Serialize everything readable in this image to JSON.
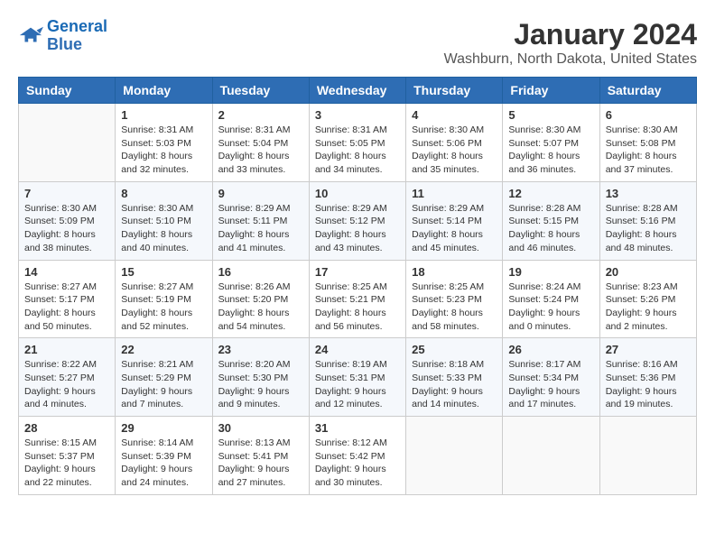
{
  "header": {
    "logo_line1": "General",
    "logo_line2": "Blue",
    "title": "January 2024",
    "subtitle": "Washburn, North Dakota, United States"
  },
  "days_of_week": [
    "Sunday",
    "Monday",
    "Tuesday",
    "Wednesday",
    "Thursday",
    "Friday",
    "Saturday"
  ],
  "weeks": [
    [
      {
        "day": "",
        "info": ""
      },
      {
        "day": "1",
        "info": "Sunrise: 8:31 AM\nSunset: 5:03 PM\nDaylight: 8 hours\nand 32 minutes."
      },
      {
        "day": "2",
        "info": "Sunrise: 8:31 AM\nSunset: 5:04 PM\nDaylight: 8 hours\nand 33 minutes."
      },
      {
        "day": "3",
        "info": "Sunrise: 8:31 AM\nSunset: 5:05 PM\nDaylight: 8 hours\nand 34 minutes."
      },
      {
        "day": "4",
        "info": "Sunrise: 8:30 AM\nSunset: 5:06 PM\nDaylight: 8 hours\nand 35 minutes."
      },
      {
        "day": "5",
        "info": "Sunrise: 8:30 AM\nSunset: 5:07 PM\nDaylight: 8 hours\nand 36 minutes."
      },
      {
        "day": "6",
        "info": "Sunrise: 8:30 AM\nSunset: 5:08 PM\nDaylight: 8 hours\nand 37 minutes."
      }
    ],
    [
      {
        "day": "7",
        "info": "Sunrise: 8:30 AM\nSunset: 5:09 PM\nDaylight: 8 hours\nand 38 minutes."
      },
      {
        "day": "8",
        "info": "Sunrise: 8:30 AM\nSunset: 5:10 PM\nDaylight: 8 hours\nand 40 minutes."
      },
      {
        "day": "9",
        "info": "Sunrise: 8:29 AM\nSunset: 5:11 PM\nDaylight: 8 hours\nand 41 minutes."
      },
      {
        "day": "10",
        "info": "Sunrise: 8:29 AM\nSunset: 5:12 PM\nDaylight: 8 hours\nand 43 minutes."
      },
      {
        "day": "11",
        "info": "Sunrise: 8:29 AM\nSunset: 5:14 PM\nDaylight: 8 hours\nand 45 minutes."
      },
      {
        "day": "12",
        "info": "Sunrise: 8:28 AM\nSunset: 5:15 PM\nDaylight: 8 hours\nand 46 minutes."
      },
      {
        "day": "13",
        "info": "Sunrise: 8:28 AM\nSunset: 5:16 PM\nDaylight: 8 hours\nand 48 minutes."
      }
    ],
    [
      {
        "day": "14",
        "info": "Sunrise: 8:27 AM\nSunset: 5:17 PM\nDaylight: 8 hours\nand 50 minutes."
      },
      {
        "day": "15",
        "info": "Sunrise: 8:27 AM\nSunset: 5:19 PM\nDaylight: 8 hours\nand 52 minutes."
      },
      {
        "day": "16",
        "info": "Sunrise: 8:26 AM\nSunset: 5:20 PM\nDaylight: 8 hours\nand 54 minutes."
      },
      {
        "day": "17",
        "info": "Sunrise: 8:25 AM\nSunset: 5:21 PM\nDaylight: 8 hours\nand 56 minutes."
      },
      {
        "day": "18",
        "info": "Sunrise: 8:25 AM\nSunset: 5:23 PM\nDaylight: 8 hours\nand 58 minutes."
      },
      {
        "day": "19",
        "info": "Sunrise: 8:24 AM\nSunset: 5:24 PM\nDaylight: 9 hours\nand 0 minutes."
      },
      {
        "day": "20",
        "info": "Sunrise: 8:23 AM\nSunset: 5:26 PM\nDaylight: 9 hours\nand 2 minutes."
      }
    ],
    [
      {
        "day": "21",
        "info": "Sunrise: 8:22 AM\nSunset: 5:27 PM\nDaylight: 9 hours\nand 4 minutes."
      },
      {
        "day": "22",
        "info": "Sunrise: 8:21 AM\nSunset: 5:29 PM\nDaylight: 9 hours\nand 7 minutes."
      },
      {
        "day": "23",
        "info": "Sunrise: 8:20 AM\nSunset: 5:30 PM\nDaylight: 9 hours\nand 9 minutes."
      },
      {
        "day": "24",
        "info": "Sunrise: 8:19 AM\nSunset: 5:31 PM\nDaylight: 9 hours\nand 12 minutes."
      },
      {
        "day": "25",
        "info": "Sunrise: 8:18 AM\nSunset: 5:33 PM\nDaylight: 9 hours\nand 14 minutes."
      },
      {
        "day": "26",
        "info": "Sunrise: 8:17 AM\nSunset: 5:34 PM\nDaylight: 9 hours\nand 17 minutes."
      },
      {
        "day": "27",
        "info": "Sunrise: 8:16 AM\nSunset: 5:36 PM\nDaylight: 9 hours\nand 19 minutes."
      }
    ],
    [
      {
        "day": "28",
        "info": "Sunrise: 8:15 AM\nSunset: 5:37 PM\nDaylight: 9 hours\nand 22 minutes."
      },
      {
        "day": "29",
        "info": "Sunrise: 8:14 AM\nSunset: 5:39 PM\nDaylight: 9 hours\nand 24 minutes."
      },
      {
        "day": "30",
        "info": "Sunrise: 8:13 AM\nSunset: 5:41 PM\nDaylight: 9 hours\nand 27 minutes."
      },
      {
        "day": "31",
        "info": "Sunrise: 8:12 AM\nSunset: 5:42 PM\nDaylight: 9 hours\nand 30 minutes."
      },
      {
        "day": "",
        "info": ""
      },
      {
        "day": "",
        "info": ""
      },
      {
        "day": "",
        "info": ""
      }
    ]
  ]
}
